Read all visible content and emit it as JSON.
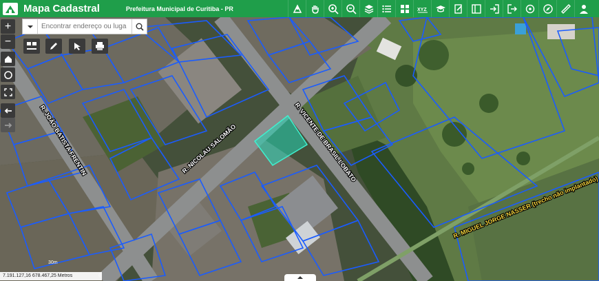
{
  "header": {
    "app_title": "Mapa Cadastral",
    "organization": "Prefeitura Municipal de Curitiba - PR"
  },
  "toolbar": {
    "tools": [
      "map-pin-icon",
      "pan-hand-icon",
      "zoom-in-icon",
      "zoom-out-icon",
      "layers-icon",
      "list-icon",
      "grid-icon",
      "xyz-icon",
      "print-cap-icon",
      "edit-doc-icon",
      "split-panel-icon",
      "login-icon",
      "logout-icon",
      "target-icon",
      "compass-icon",
      "ruler-icon",
      "user-icon"
    ]
  },
  "search": {
    "placeholder": "Encontrar endereço ou luga"
  },
  "map": {
    "streets": [
      "R. JOÃO BATISTA FRENTIN",
      "R. NICOLAU SALOMÃO",
      "R. VICENTE DE BRASIL LOBATO",
      "R. MIGUEL JORGE NASSER (trecho não implantado)"
    ],
    "scale_label": "30m",
    "coordinates": "7.191.127,16 678.467,25 Metros"
  },
  "colors": {
    "header_green": "#1f9e4a",
    "parcel_blue": "#1a5cff",
    "selected_parcel": "#24d6b4"
  }
}
